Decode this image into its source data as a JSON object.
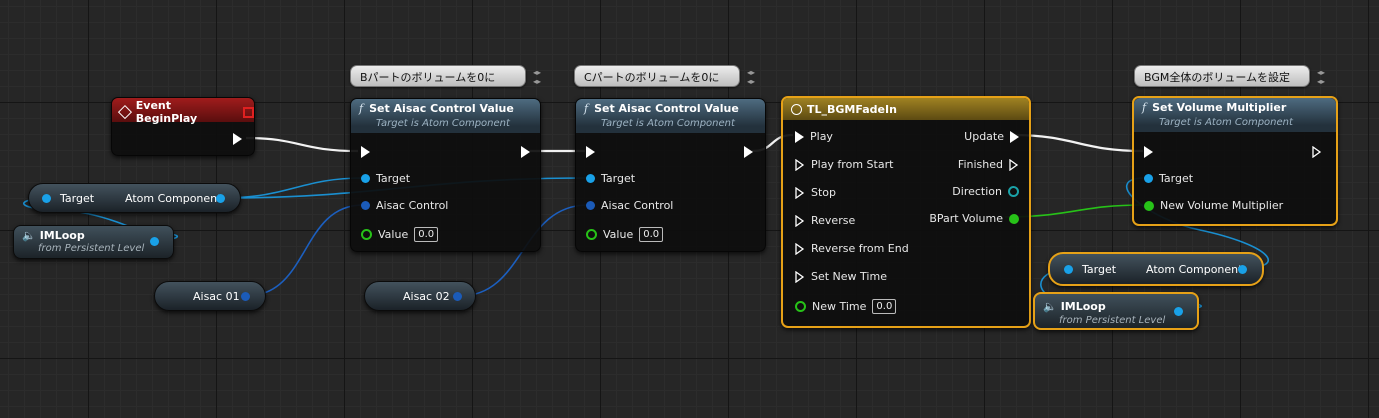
{
  "event": {
    "title": "Event BeginPlay"
  },
  "comments": [
    "Bパートのボリュームを0に",
    "Cパートのボリュームを0に",
    "BGM全体のボリュームを設定"
  ],
  "set_aisac_1": {
    "title": "Set Aisac Control Value",
    "subtitle": "Target is Atom Component",
    "pins": [
      "Target",
      "Aisac Control",
      "Value"
    ],
    "value": "0.0"
  },
  "set_aisac_2": {
    "title": "Set Aisac Control Value",
    "subtitle": "Target is Atom Component",
    "pins": [
      "Target",
      "Aisac Control",
      "Value"
    ],
    "value": "0.0"
  },
  "timeline": {
    "title": "TL_BGMFadeIn",
    "inputs": [
      "Play",
      "Play from Start",
      "Stop",
      "Reverse",
      "Reverse from End",
      "Set New Time",
      "New Time"
    ],
    "new_time": "0.0",
    "outputs": [
      "Update",
      "Finished",
      "Direction",
      "BPart Volume"
    ]
  },
  "set_volume": {
    "title": "Set Volume Multiplier",
    "subtitle": "Target is Atom Component",
    "pins": [
      "Target",
      "New Volume Multiplier"
    ]
  },
  "vars": {
    "target_left": {
      "label": "Target",
      "value": "Atom Component"
    },
    "target_right": {
      "label": "Target",
      "value": "Atom Component"
    },
    "aisac01": "Aisac 01",
    "aisac02": "Aisac 02"
  },
  "imloop_left": {
    "title": "IMLoop",
    "subtitle": "from Persistent Level"
  },
  "imloop_right": {
    "title": "IMLoop",
    "subtitle": "from Persistent Level"
  },
  "colors": {
    "exec": "#ffffff",
    "object": "#19a1e8",
    "float": "#27c218",
    "selection": "#e6a117",
    "event_header": "#8c1515",
    "timeline_header": "#7a6619"
  }
}
